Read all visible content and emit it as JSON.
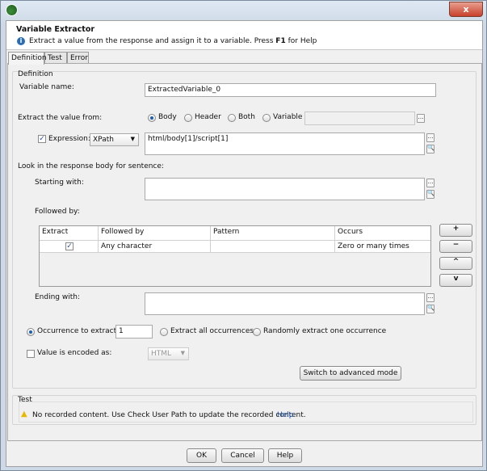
{
  "window": {
    "close_label": "x"
  },
  "header": {
    "title": "Variable Extractor",
    "info_pre": "Extract a value from the response and assign it to a variable. Press ",
    "info_key": "F1",
    "info_post": " for Help"
  },
  "tabs": [
    {
      "label": "Definition"
    },
    {
      "label": "Test"
    },
    {
      "label": "Error"
    }
  ],
  "definition": {
    "group_label": "Definition",
    "variable_name_label": "Variable name:",
    "variable_name_value": "ExtractedVariable_0",
    "extract_from_label": "Extract the value from:",
    "extract_options": [
      "Body",
      "Header",
      "Both",
      "Variable"
    ],
    "extract_selected": "Body",
    "variable_value": "",
    "expression_label": "Expression:",
    "expression_checked": true,
    "expression_type": "XPath",
    "expression_value": "html/body[1]/script[1]",
    "look_label": "Look in the response body for sentence:",
    "starting_label": "Starting with:",
    "starting_value": "",
    "followed_label": "Followed by:",
    "table": {
      "columns": [
        "Extract",
        "Followed by",
        "Pattern",
        "Occurs"
      ],
      "rows": [
        {
          "extract": true,
          "followed_by": "Any character",
          "pattern": "",
          "occurs": "Zero or many times"
        }
      ]
    },
    "table_buttons": [
      "+",
      "−",
      "^",
      "v"
    ],
    "ending_label": "Ending with:",
    "ending_value": "",
    "occurrence_label": "Occurrence to extract:",
    "occurrence_value": "1",
    "extract_all_label": "Extract all occurrences",
    "random_label": "Randomly extract one occurrence",
    "encoded_label": "Value is encoded as:",
    "encoded_value": "HTML",
    "advanced_button": "Switch to advanced mode"
  },
  "test": {
    "group_label": "Test",
    "message": "No recorded content. Use Check User Path to update the recorded content.",
    "help_link": "Help"
  },
  "footer": {
    "ok": "OK",
    "cancel": "Cancel",
    "help": "Help"
  },
  "colors": {
    "link": "#1f55b0",
    "warning": "#e8b800"
  }
}
